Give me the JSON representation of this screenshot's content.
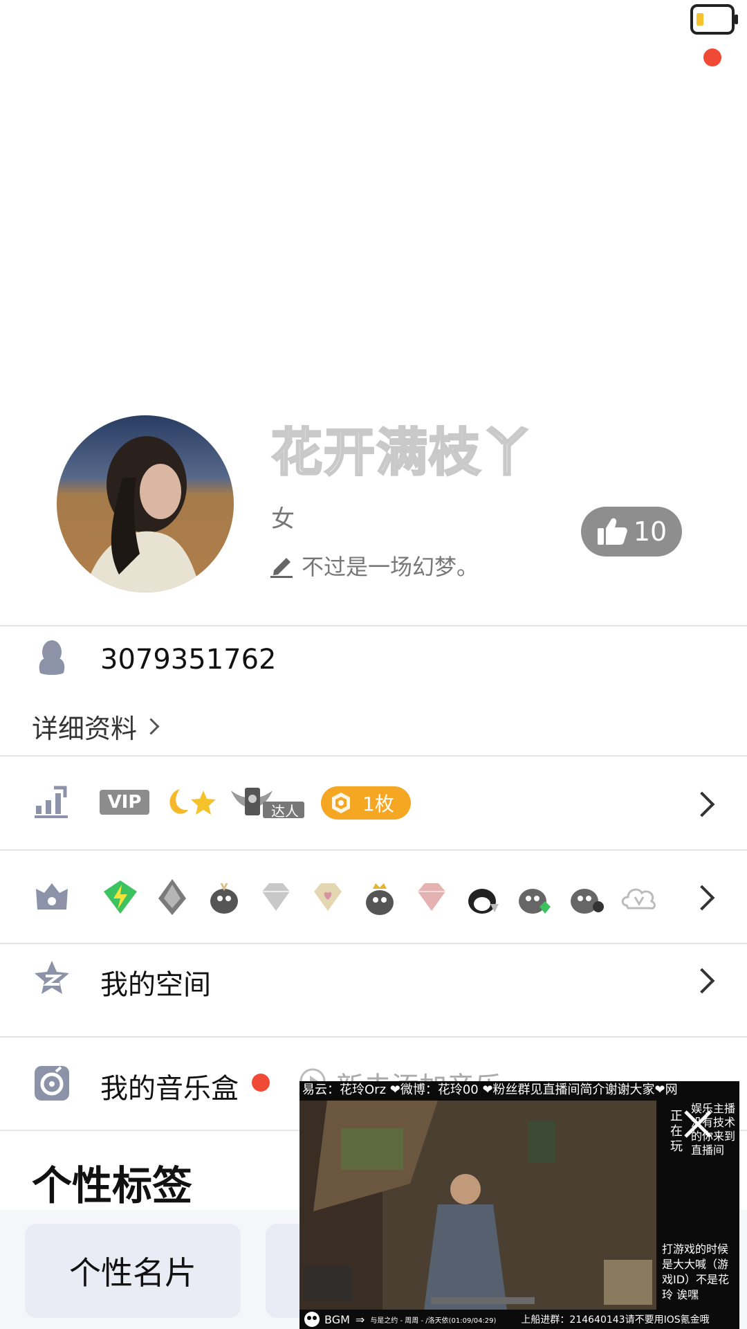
{
  "profile": {
    "nickname": "花开满枝丫",
    "gender": "女",
    "signature": "不过是一场幻梦。",
    "likes": "10"
  },
  "account": {
    "qq_number": "3079351762",
    "details_label": "详细资料"
  },
  "level_row": {
    "vip_label": "VIP",
    "expert_label": "达人",
    "coin_label": "1枚"
  },
  "rows": {
    "space_label": "我的空间",
    "music_label": "我的音乐盒",
    "music_add_label": "新去添加音乐"
  },
  "tags": {
    "title": "个性标签",
    "card_label": "个性名片"
  },
  "video": {
    "top_ticker": "易云：花玲Orz ❤微博：花玲00 ❤粉丝群见直播间简介谢谢大家❤网",
    "side_text": "正在玩",
    "side_note": "娱乐主播没有技术的你来到直播间",
    "bottom_note": "打游戏的时候是大大喊（游戏ID）不是花玲 诶嘿",
    "bgm_label": "BGM",
    "bgm_track": "与是之约 - 周周 - /洛天依(01:09/04:29)",
    "footer_text": "上船进群：214640143请不要用IOS氪金哦"
  },
  "colors": {
    "accent_orange": "#F5A623",
    "red_dot": "#F04A36",
    "icon_gray": "#8C93A8",
    "like_bg": "#8E8E8E"
  }
}
